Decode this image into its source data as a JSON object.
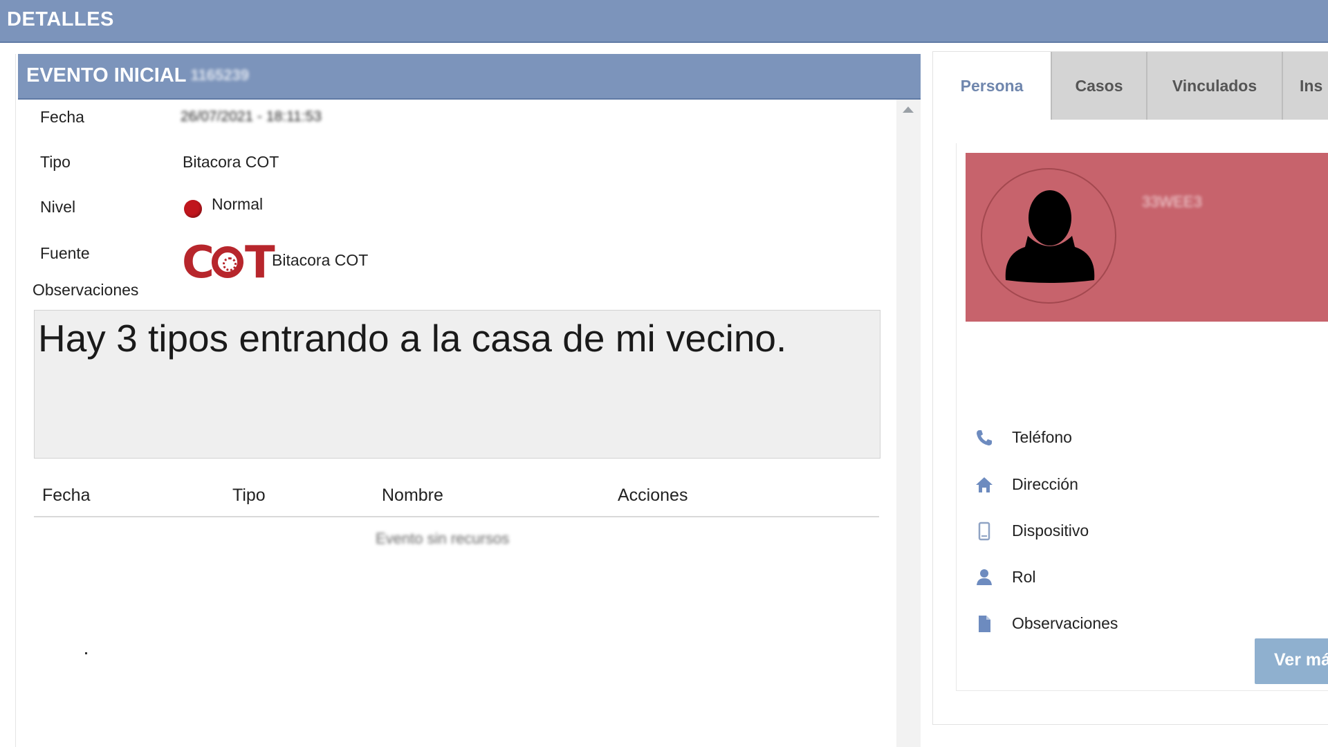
{
  "header": {
    "title": "DETALLES"
  },
  "evento": {
    "title": "EVENTO INICIAL",
    "id_blurred": "1165239",
    "fields": {
      "fecha_label": "Fecha",
      "fecha_value": "26/07/2021 - 18:11:53",
      "tipo_label": "Tipo",
      "tipo_value": "Bitacora COT",
      "nivel_label": "Nivel",
      "nivel_value": "Normal",
      "nivel_color": "#c0161d",
      "fuente_label": "Fuente",
      "fuente_logo_text": "COT",
      "fuente_value": "Bitacora COT",
      "observaciones_label": "Observaciones",
      "observaciones_value": "Hay 3 tipos entrando a la casa de mi vecino."
    },
    "table": {
      "columns": [
        "Fecha",
        "Tipo",
        "Nombre",
        "Acciones"
      ],
      "empty_message": "Evento sin recursos"
    }
  },
  "right": {
    "tabs": [
      {
        "label": "Persona",
        "active": true
      },
      {
        "label": "Casos",
        "active": false
      },
      {
        "label": "Vinculados",
        "active": false
      },
      {
        "label": "Ins",
        "active": false
      }
    ],
    "person": {
      "name_blurred": "33WEE3",
      "banner_color": "#c7636c"
    },
    "info_items": [
      {
        "icon": "phone-icon",
        "label": "Teléfono"
      },
      {
        "icon": "home-icon",
        "label": "Dirección"
      },
      {
        "icon": "device-icon",
        "label": "Dispositivo"
      },
      {
        "icon": "user-icon",
        "label": "Rol"
      },
      {
        "icon": "document-icon",
        "label": "Observaciones"
      }
    ],
    "ver_mas_label": "Ver más"
  }
}
